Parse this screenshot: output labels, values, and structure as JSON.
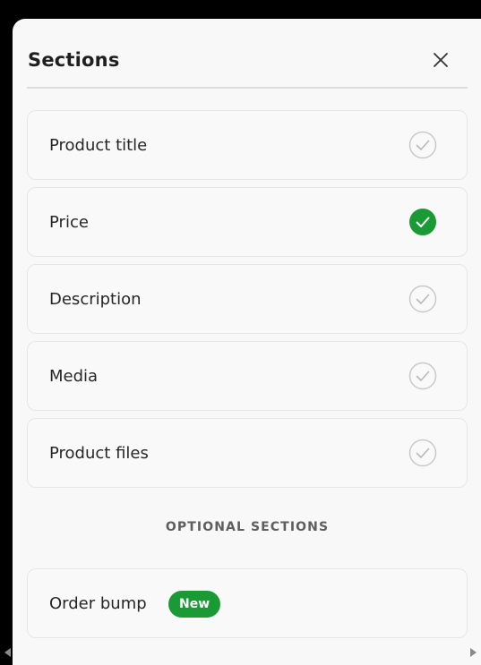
{
  "panel": {
    "title": "Sections",
    "close_icon": "close-icon"
  },
  "sections": [
    {
      "label": "Product title",
      "completed": false
    },
    {
      "label": "Price",
      "completed": true
    },
    {
      "label": "Description",
      "completed": false
    },
    {
      "label": "Media",
      "completed": false
    },
    {
      "label": "Product files",
      "completed": false
    }
  ],
  "optional": {
    "heading": "OPTIONAL SECTIONS",
    "items": [
      {
        "label": "Order bump",
        "badge": "New"
      }
    ]
  },
  "colors": {
    "success": "#1a9a35",
    "check_outline": "#c9c9c9"
  }
}
